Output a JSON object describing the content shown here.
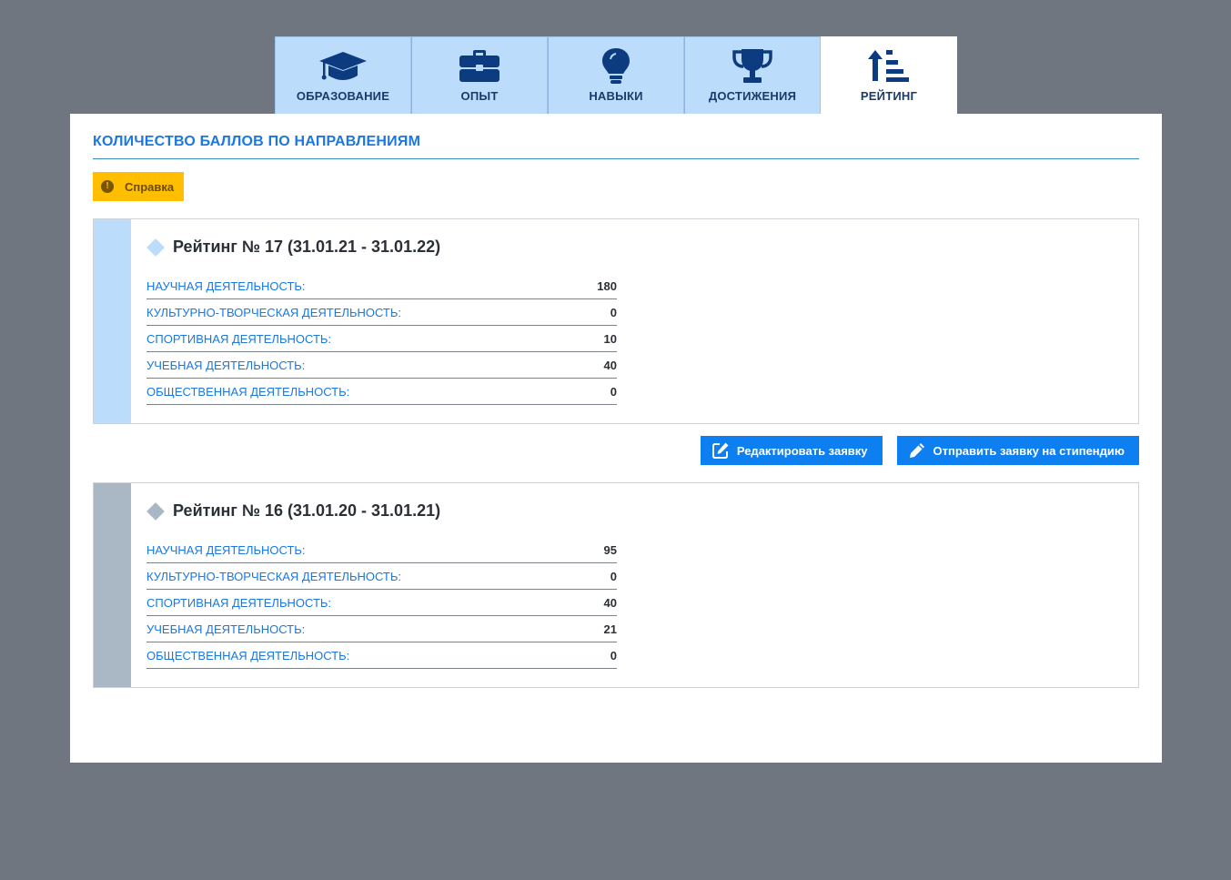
{
  "tabs": [
    {
      "label": "ОБРАЗОВАНИЕ",
      "icon": "graduation-cap-icon",
      "active": false
    },
    {
      "label": "ОПЫТ",
      "icon": "briefcase-icon",
      "active": false
    },
    {
      "label": "НАВЫКИ",
      "icon": "lightbulb-icon",
      "active": false
    },
    {
      "label": "ДОСТИЖЕНИЯ",
      "icon": "trophy-icon",
      "active": false
    },
    {
      "label": "РЕЙТИНГ",
      "icon": "sort-amount-up-icon",
      "active": true
    }
  ],
  "section_title": "КОЛИЧЕСТВО БАЛЛОВ ПО НАПРАВЛЕНИЯМ",
  "help_label": "Справка",
  "ratings": [
    {
      "title": "Рейтинг № 17 (31.01.21 - 31.01.22)",
      "accent": "#bcdcfc",
      "rows": [
        {
          "label": "НАУЧНАЯ ДЕЯТЕЛЬНОСТЬ:",
          "value": "180"
        },
        {
          "label": "КУЛЬТУРНО-ТВОРЧЕСКАЯ ДЕЯТЕЛЬНОСТЬ:",
          "value": "0"
        },
        {
          "label": "СПОРТИВНАЯ ДЕЯТЕЛЬНОСТЬ:",
          "value": "10"
        },
        {
          "label": "УЧЕБНАЯ ДЕЯТЕЛЬНОСТЬ:",
          "value": "40"
        },
        {
          "label": "ОБЩЕСТВЕННАЯ ДЕЯТЕЛЬНОСТЬ:",
          "value": "0"
        }
      ]
    },
    {
      "title": "Рейтинг № 16 (31.01.20 - 31.01.21)",
      "accent": "#aab8c6",
      "rows": [
        {
          "label": "НАУЧНАЯ ДЕЯТЕЛЬНОСТЬ:",
          "value": "95"
        },
        {
          "label": "КУЛЬТУРНО-ТВОРЧЕСКАЯ ДЕЯТЕЛЬНОСТЬ:",
          "value": "0"
        },
        {
          "label": "СПОРТИВНАЯ ДЕЯТЕЛЬНОСТЬ:",
          "value": "40"
        },
        {
          "label": "УЧЕБНАЯ ДЕЯТЕЛЬНОСТЬ:",
          "value": "21"
        },
        {
          "label": "ОБЩЕСТВЕННАЯ ДЕЯТЕЛЬНОСТЬ:",
          "value": "0"
        }
      ]
    }
  ],
  "actions": {
    "edit_label": "Редактировать заявку",
    "submit_label": "Отправить заявку на стипендию"
  },
  "colors": {
    "accent_blue": "#0d7ff0",
    "tab_bg": "#bcdcfc",
    "help_bg": "#ffbf00",
    "icon_navy": "#0d3b80"
  }
}
